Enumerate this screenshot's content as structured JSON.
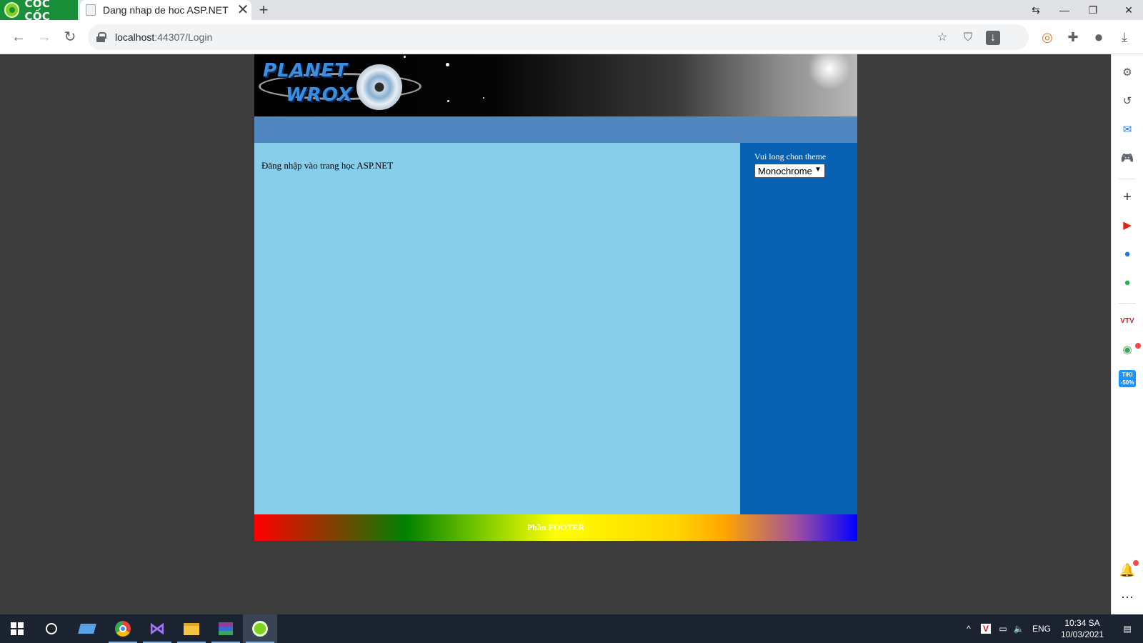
{
  "browser": {
    "brand": "CỐC CỐC",
    "tab_title": "Dang nhap de hoc ASP.NET",
    "url_host": "localhost",
    "url_rest": ":44307/Login"
  },
  "page": {
    "logo_line1": "PLANET",
    "logo_line2": "WROX",
    "main_text": "Đăng nhập vào trang học ASP.NET",
    "theme_label": "Vui long chon theme",
    "theme_selected": "Monochrome",
    "footer": "Phần FOOTER"
  },
  "taskbar": {
    "language": "ENG",
    "time": "10:34 SA",
    "date": "10/03/2021"
  },
  "sidebar_promo": {
    "tiki": "TIKI",
    "tiki_discount": "-50%",
    "vtv": "VTV"
  }
}
